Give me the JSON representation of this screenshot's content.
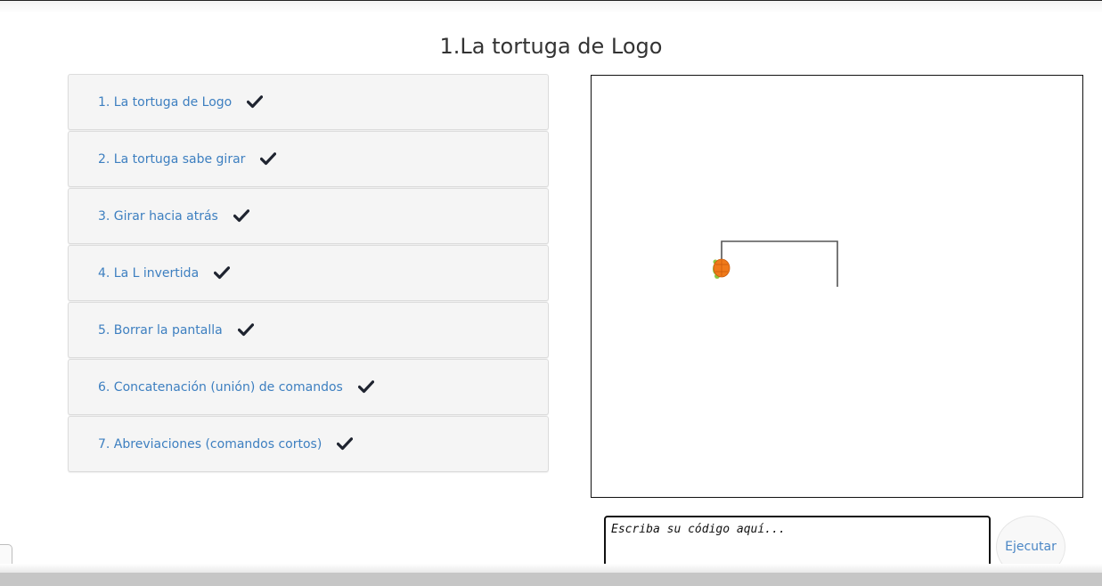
{
  "page": {
    "title": "1.La tortuga de Logo"
  },
  "lessons": [
    {
      "label": "1. La tortuga de Logo",
      "completed": true
    },
    {
      "label": "2. La tortuga sabe girar",
      "completed": true
    },
    {
      "label": "3. Girar hacia atrás",
      "completed": true
    },
    {
      "label": "4. La L invertida",
      "completed": true
    },
    {
      "label": "5. Borrar la pantalla",
      "completed": true
    },
    {
      "label": "6. Concatenación (unión) de comandos",
      "completed": true
    },
    {
      "label": "7. Abreviaciones (comandos cortos)",
      "completed": true
    }
  ],
  "editor": {
    "placeholder": "Escriba su código aquí...",
    "value": ""
  },
  "run_button": {
    "label": "Ejecutar"
  },
  "icons": {
    "completed": "checkmark-icon",
    "turtle": "turtle-icon"
  },
  "colors": {
    "link": "#3d7fc0",
    "check": "#1f2430",
    "turtle_shell": "#f07a1a",
    "turtle_body": "#8dc63f"
  }
}
